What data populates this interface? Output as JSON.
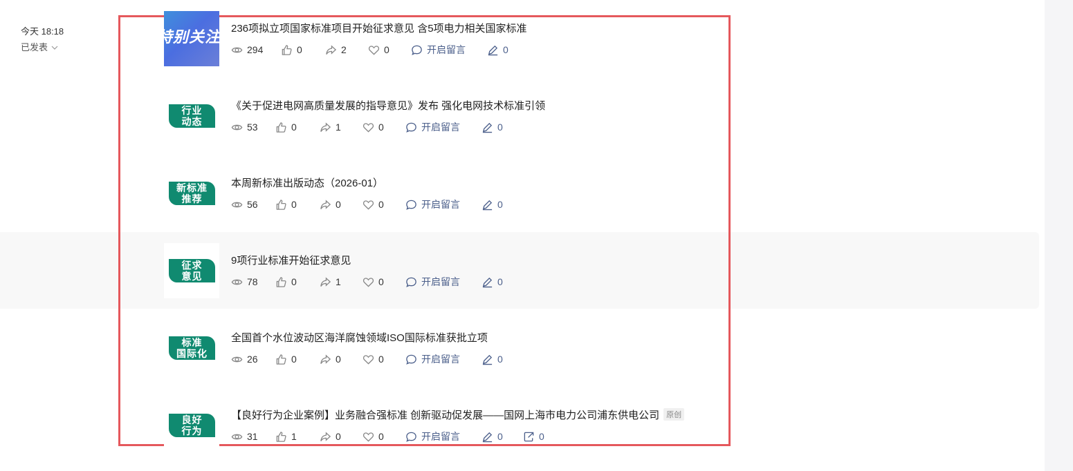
{
  "publish": {
    "time": "今天 18:18",
    "status": "已发表"
  },
  "articles": [
    {
      "title": "236项拟立项国家标准项目开始征求意见 含5项电力相关国家标准",
      "thumb_text": "特别关注",
      "reads": "294",
      "likes": "0",
      "shares": "2",
      "loves": "0",
      "comment_label": "开启留言",
      "notes": "0"
    },
    {
      "title": "《关于促进电网高质量发展的指导意见》发布   强化电网技术标准引领",
      "tag": [
        "行业",
        "动态"
      ],
      "reads": "53",
      "likes": "0",
      "shares": "1",
      "loves": "0",
      "comment_label": "开启留言",
      "notes": "0"
    },
    {
      "title": "本周新标准出版动态（2026-01）",
      "tag": [
        "新标准",
        "推荐"
      ],
      "reads": "56",
      "likes": "0",
      "shares": "0",
      "loves": "0",
      "comment_label": "开启留言",
      "notes": "0"
    },
    {
      "title": "9项行业标准开始征求意见",
      "tag": [
        "征求",
        "意见"
      ],
      "reads": "78",
      "likes": "0",
      "shares": "1",
      "loves": "0",
      "comment_label": "开启留言",
      "notes": "0"
    },
    {
      "title": "全国首个水位波动区海洋腐蚀领域ISO国际标准获批立项",
      "tag": [
        "标准",
        "国际化"
      ],
      "reads": "26",
      "likes": "0",
      "shares": "0",
      "loves": "0",
      "comment_label": "开启留言",
      "notes": "0"
    },
    {
      "title": "【良好行为企业案例】业务融合强标准 创新驱动促发展——国网上海市电力公司浦东供电公司",
      "badge": "原创",
      "tag": [
        "良好",
        "行为"
      ],
      "reads": "31",
      "likes": "1",
      "shares": "0",
      "loves": "0",
      "comment_label": "开启留言",
      "notes": "0",
      "reposts": "0"
    }
  ],
  "colors": {
    "highlight": "#e5585c",
    "tag_green": "#108a70",
    "link_blue": "#4a5e8a"
  }
}
